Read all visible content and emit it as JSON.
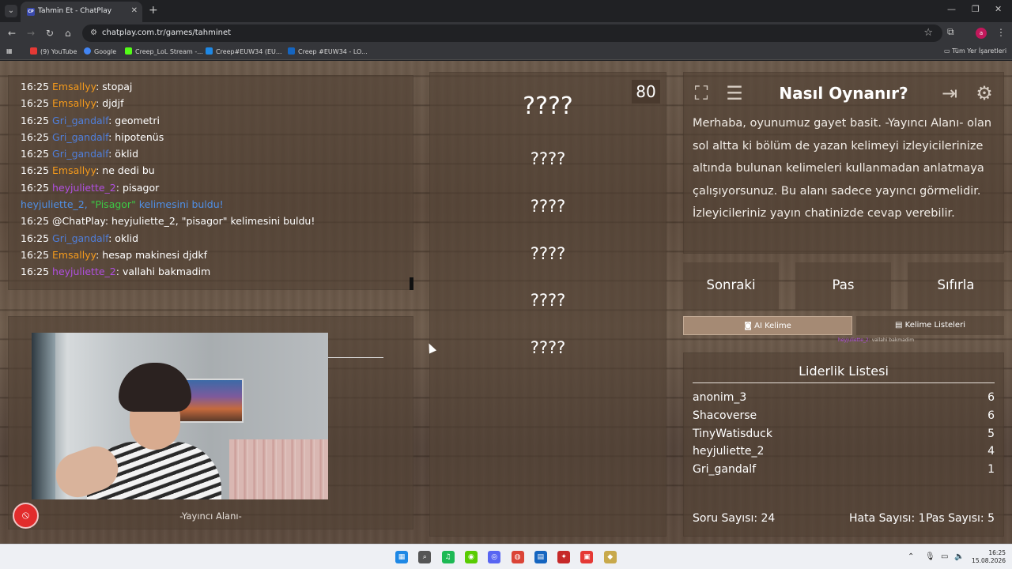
{
  "browser": {
    "tab_title": "Tahmin Et - ChatPlay",
    "tab_favicon": "CP",
    "url": "chatplay.com.tr/games/tahminet",
    "bookmarks": [
      {
        "label": "(9) YouTube",
        "color": "#e53935"
      },
      {
        "label": "Google",
        "color": "#4285f4"
      },
      {
        "label": "Creep_LoL Stream -...",
        "color": "#53fc18"
      },
      {
        "label": "Creep#EUW34 (EU...",
        "color": "#1e88e5"
      },
      {
        "label": "Creep #EUW34 - LO...",
        "color": "#1565c0"
      }
    ],
    "all_bookmarks": "Tüm Yer İşaretleri",
    "profile_initial": "a"
  },
  "chat": {
    "messages": [
      {
        "time": "16:25",
        "user": "Emsallyy",
        "color": "orange",
        "text": ": stopaj"
      },
      {
        "time": "16:25",
        "user": "Emsallyy",
        "color": "orange",
        "text": ": djdjf"
      },
      {
        "time": "16:25",
        "user": "Gri_gandalf",
        "color": "blue",
        "text": ": geometri"
      },
      {
        "time": "16:25",
        "user": "Gri_gandalf",
        "color": "blue",
        "text": ": hipotenüs"
      },
      {
        "time": "16:25",
        "user": "Gri_gandalf",
        "color": "blue",
        "text": ": öklid"
      },
      {
        "time": "16:25",
        "user": "Emsallyy",
        "color": "orange",
        "text": ": ne dedi bu"
      },
      {
        "time": "16:25",
        "user": "heyjuliette_2",
        "color": "purple",
        "text": ": pisagor"
      }
    ],
    "system": {
      "user": "heyjuliette_2,",
      "word": " \"Pisagor\"",
      "rest": " kelimesini buldu!"
    },
    "announce": {
      "time": "16:25",
      "text": " @ChatPlay: heyjuliette_2, \"pisagor\" kelimesini buldu!"
    },
    "messages2": [
      {
        "time": "16:25",
        "user": "Gri_gandalf",
        "color": "blue",
        "text": ": oklid"
      },
      {
        "time": "16:25",
        "user": "Emsallyy",
        "color": "orange",
        "text": ": hesap makinesi djdkf"
      },
      {
        "time": "16:25",
        "user": "heyjuliette_2",
        "color": "purple",
        "text": ": vallahi bakmadim"
      }
    ]
  },
  "streamer_area": {
    "label": "-Yayıncı Alanı-"
  },
  "words": {
    "main": "????",
    "forbidden": [
      "????",
      "????",
      "????",
      "????",
      "????"
    ],
    "timer": "80"
  },
  "info": {
    "title": "Nasıl Oynanır?",
    "text": "Merhaba, oyunumuz gayet basit. -Yayıncı Alanı- olan sol altta ki bölüm de yazan kelimeyi izleyicilerinize altında bulunan kelimeleri kullanmadan anlatmaya çalışıyorsunuz. Bu alanı sadece yayıncı görmelidir. İzleyicileriniz yayın chatinizde cevap verebilir."
  },
  "controls": {
    "next": "Sonraki",
    "pass": "Pas",
    "reset": "Sıfırla"
  },
  "tabs": {
    "ai": "AI Kelime",
    "lists": "Kelime Listeleri"
  },
  "mini_note": {
    "user": "heyjuliette_2:",
    "text": " vallahi bakmadim"
  },
  "leaderboard": {
    "title": "Liderlik Listesi",
    "rows": [
      {
        "name": "anonim_3",
        "score": "6"
      },
      {
        "name": "Shacoverse",
        "score": "6"
      },
      {
        "name": "TinyWatisduck",
        "score": "5"
      },
      {
        "name": "heyjuliette_2",
        "score": "4"
      },
      {
        "name": "Gri_gandalf",
        "score": "1"
      }
    ],
    "question_count": "Soru Sayısı: 24",
    "error_count": "Hata Sayısı: 1",
    "pass_count": "Pas Sayısı: 5"
  },
  "taskbar": {
    "time": "16:25",
    "date": "15.08.2026",
    "apps": [
      {
        "name": "windows-start",
        "color": "#1e88e5",
        "glyph": "▦"
      },
      {
        "name": "search",
        "color": "#555555",
        "glyph": "⌕"
      },
      {
        "name": "spotify",
        "color": "#1db954",
        "glyph": "♫"
      },
      {
        "name": "duolingo",
        "color": "#58cc02",
        "glyph": "◉"
      },
      {
        "name": "discord",
        "color": "#5865f2",
        "glyph": "◎"
      },
      {
        "name": "chrome",
        "color": "#db4437",
        "glyph": "◍"
      },
      {
        "name": "app-files",
        "color": "#1565c0",
        "glyph": "▤"
      },
      {
        "name": "app-game",
        "color": "#c62828",
        "glyph": "✦"
      },
      {
        "name": "app-media",
        "color": "#e53935",
        "glyph": "▣"
      },
      {
        "name": "league",
        "color": "#c8a94b",
        "glyph": "◆"
      }
    ]
  }
}
